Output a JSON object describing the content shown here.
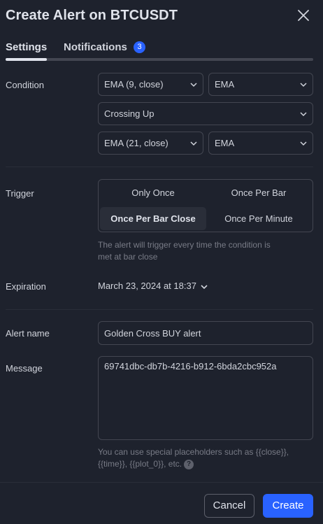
{
  "dialog": {
    "title": "Create Alert on BTCUSDT"
  },
  "tabs": {
    "settings": "Settings",
    "notifications": "Notifications",
    "notifications_badge": "3"
  },
  "condition": {
    "label": "Condition",
    "indicator_1": "EMA (9, close)",
    "indicator_1_plot": "EMA",
    "operator": "Crossing Up",
    "indicator_2": "EMA (21, close)",
    "indicator_2_plot": "EMA"
  },
  "trigger": {
    "label": "Trigger",
    "options": [
      "Only Once",
      "Once Per Bar",
      "Once Per Bar Close",
      "Once Per Minute"
    ],
    "selected": "Once Per Bar Close",
    "hint_line1": "The alert will trigger every time the condition is",
    "hint_line2": "met at bar close"
  },
  "expiration": {
    "label": "Expiration",
    "value": "March 23, 2024 at 18:37"
  },
  "alert_name": {
    "label": "Alert name",
    "value": "Golden Cross BUY alert"
  },
  "message": {
    "label": "Message",
    "value": "69741dbc-db7b-4216-b912-6bda2cbc952a",
    "hint_line1": "You can use special placeholders such as {{close}},",
    "hint_line2": "{{time}}, {{plot_0}}, etc."
  },
  "footer": {
    "cancel": "Cancel",
    "create": "Create"
  },
  "colors": {
    "background": "#1e222d",
    "accent": "#2962ff",
    "border": "#434651",
    "selected_bg": "#2a2e39",
    "hint_text": "#787b86"
  }
}
